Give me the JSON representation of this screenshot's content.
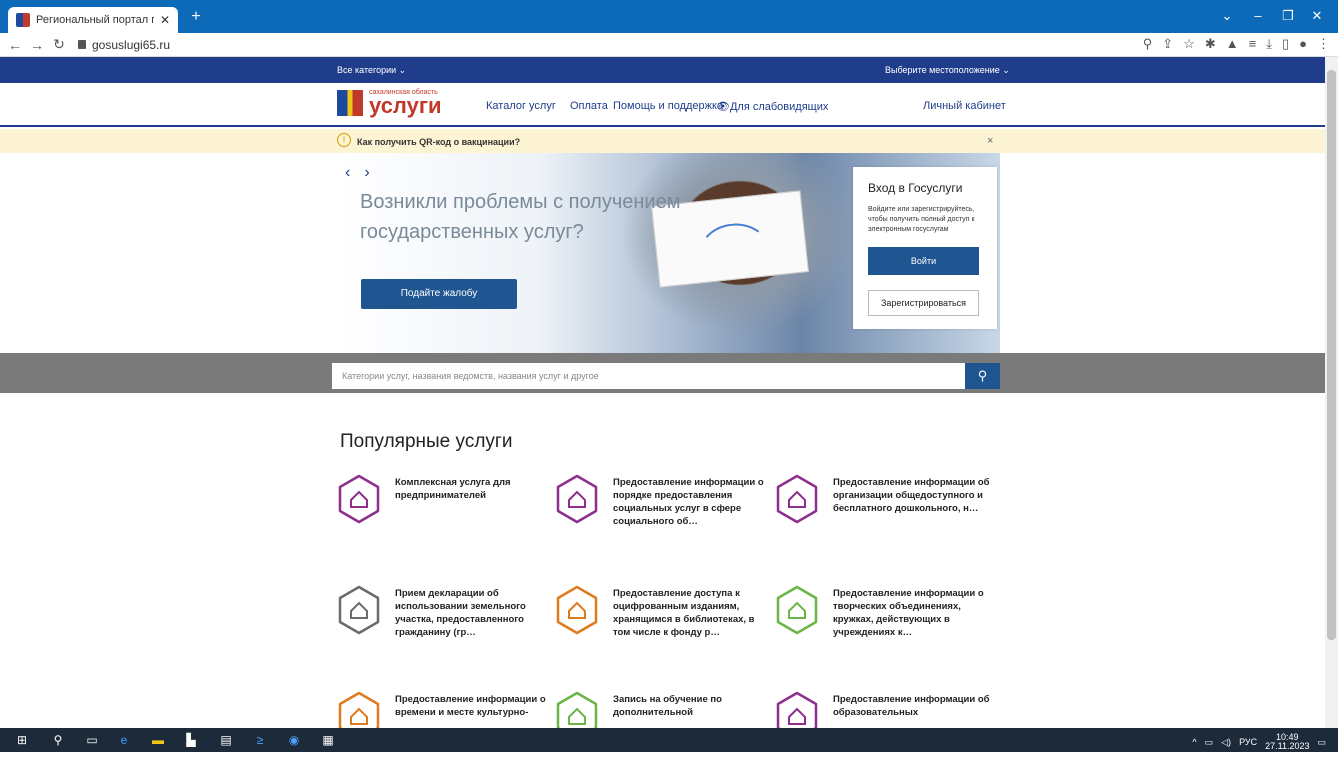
{
  "browser": {
    "tab_title": "Региональный портал государс",
    "url": "gosuslugi65.ru"
  },
  "site": {
    "top_nav": {
      "categories": "Все категории",
      "location": "Выберите местоположение"
    },
    "logo": {
      "region": "сахалинская область",
      "name": "услуги"
    },
    "menu": [
      "Каталог услуг",
      "Оплата",
      "Помощь и поддержка",
      "Для слабовидящих"
    ],
    "account": "Личный кабинет",
    "alert": {
      "text": "Как получить QR-код о вакцинации?",
      "close": "×"
    },
    "hero": {
      "title": "Возникли проблемы с получением государственных услуг?",
      "cta": "Подайте жалобу"
    },
    "login": {
      "heading": "Вход в Госуслуги",
      "description": "Войдите или зарегистрируйтесь, чтобы получить полный доступ к электронным госуслугам",
      "login_button": "Войти",
      "register_button": "Зарегистрироваться"
    },
    "search": {
      "placeholder": "Категории услуг, названия ведомств, названия услуг и другое"
    },
    "popular": {
      "title": "Популярные услуги",
      "items": [
        {
          "label": "Комплексная услуга для предпринимателей",
          "color": "#8e2f8e",
          "icon": "house-check-icon"
        },
        {
          "label": "Предоставление информации о порядке предоставления социальных услуг в сфере социального об…",
          "color": "#8e2f8e",
          "icon": "document-ruble-icon"
        },
        {
          "label": "Предоставление информации об организации общедоступного и бесплатного дошкольного, н…",
          "color": "#8e2f8e",
          "icon": "board-icon"
        },
        {
          "label": "Прием декларации об использовании земельного участка, предоставленного гражданину (гр…",
          "color": "#6b6b6b",
          "icon": "house-check-icon"
        },
        {
          "label": "Предоставление доступа к оцифрованным изданиям, хранящимся в библиотеках, в том числе к фонду р…",
          "color": "#e07a1f",
          "icon": "map-pin-icon"
        },
        {
          "label": "Предоставление информации о творческих объединениях, кружках, действующих в учреждениях к…",
          "color": "#6bb545",
          "icon": "map-pin-icon"
        },
        {
          "label": "Предоставление информации о времени и месте культурно-",
          "color": "#e07a1f",
          "icon": "map-pin-icon"
        },
        {
          "label": "Запись на обучение по дополнительной",
          "color": "#6bb545",
          "icon": "board-icon"
        },
        {
          "label": "Предоставление информации об образовательных",
          "color": "#8e2f8e",
          "icon": "board-icon"
        }
      ]
    }
  },
  "taskbar": {
    "lang": "РУС",
    "time": "10:49",
    "date": "27.11.2023"
  }
}
